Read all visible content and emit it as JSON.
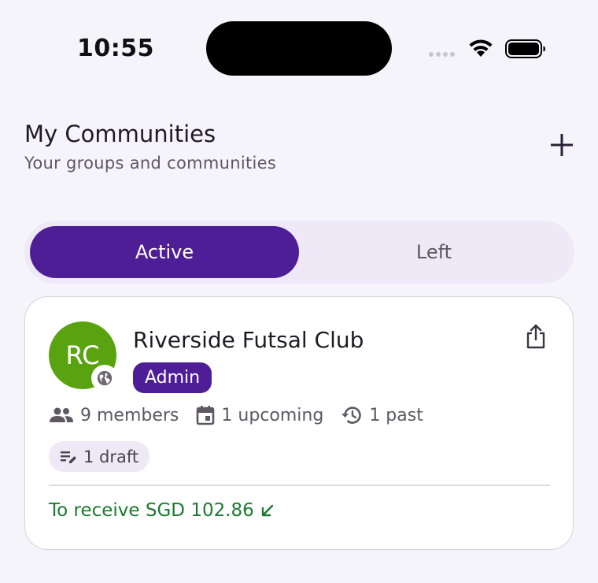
{
  "status_bar": {
    "time": "10:55"
  },
  "header": {
    "title": "My Communities",
    "subtitle": "Your groups and communities"
  },
  "tabs": [
    {
      "label": "Active",
      "selected": true
    },
    {
      "label": "Left",
      "selected": false
    }
  ],
  "community": {
    "avatar_initials": "RC",
    "avatar_color": "#5aa310",
    "name": "Riverside Futsal Club",
    "role": "Admin",
    "members": "9 members",
    "upcoming": "1 upcoming",
    "past": "1 past",
    "drafts": "1 draft",
    "receive_text": "To receive SGD 102.86"
  },
  "colors": {
    "accent": "#4e1e97",
    "positive": "#1a7a2e",
    "background": "#f6f4fb"
  },
  "icons": [
    "wifi-icon",
    "battery-icon",
    "plus-icon",
    "globe-icon",
    "share-icon",
    "people-icon",
    "calendar-icon",
    "history-icon",
    "edit-list-icon",
    "arrow-down-left-icon"
  ]
}
